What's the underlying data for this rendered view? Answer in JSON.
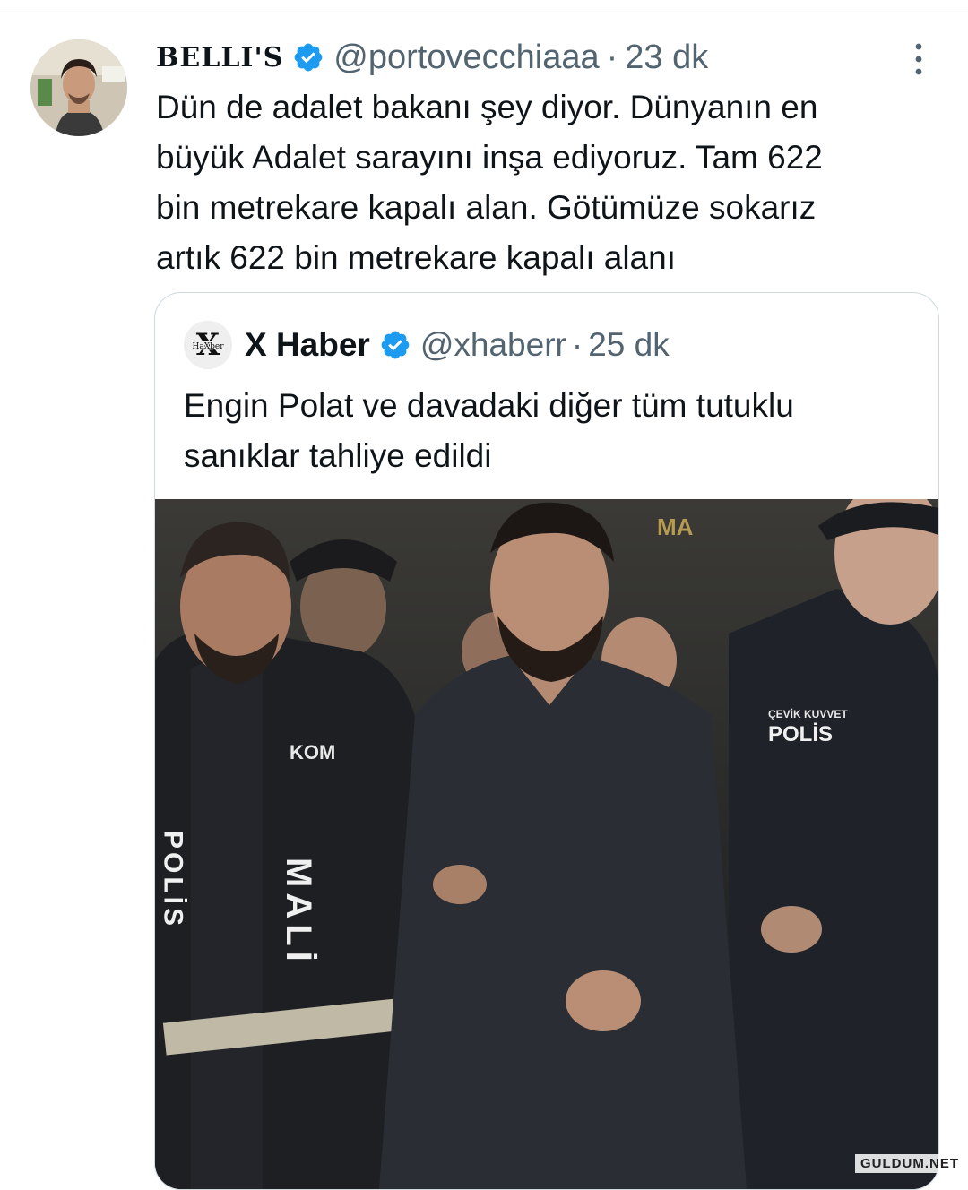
{
  "tweet": {
    "display_name": "BELLI'S",
    "handle": "@portovecchiaaa",
    "separator": "·",
    "time": "23 dk",
    "text": "Dün de adalet bakanı şey diyor. Dünyanın en\nbüyük Adalet sarayını inşa ediyoruz. Tam 622\nbin metrekare kapalı alan. Götümüze sokarız\nartık 622 bin metrekare kapalı alanı"
  },
  "quoted": {
    "display_name": "X Haber",
    "handle": "@xhaberr",
    "separator": "·",
    "time": "25 dk",
    "text": "Engin Polat ve davadaki diğer tüm tutuklu\nsanıklar tahliye edildi",
    "avatar_text": "HaXber",
    "photo_labels": {
      "left_vest": "KOM",
      "left_back": "MALİ",
      "left_side": "POLİS",
      "right_chest": "POLİS",
      "right_badge": "ÇEVİK KUVVET",
      "sign": "MA"
    }
  },
  "watermark": "GULDUM.NET",
  "colors": {
    "verified": "#1d9bf0",
    "secondary_text": "#536471",
    "border": "#cfd9de"
  },
  "icons": [
    "verified-badge-icon",
    "more-options-icon"
  ]
}
